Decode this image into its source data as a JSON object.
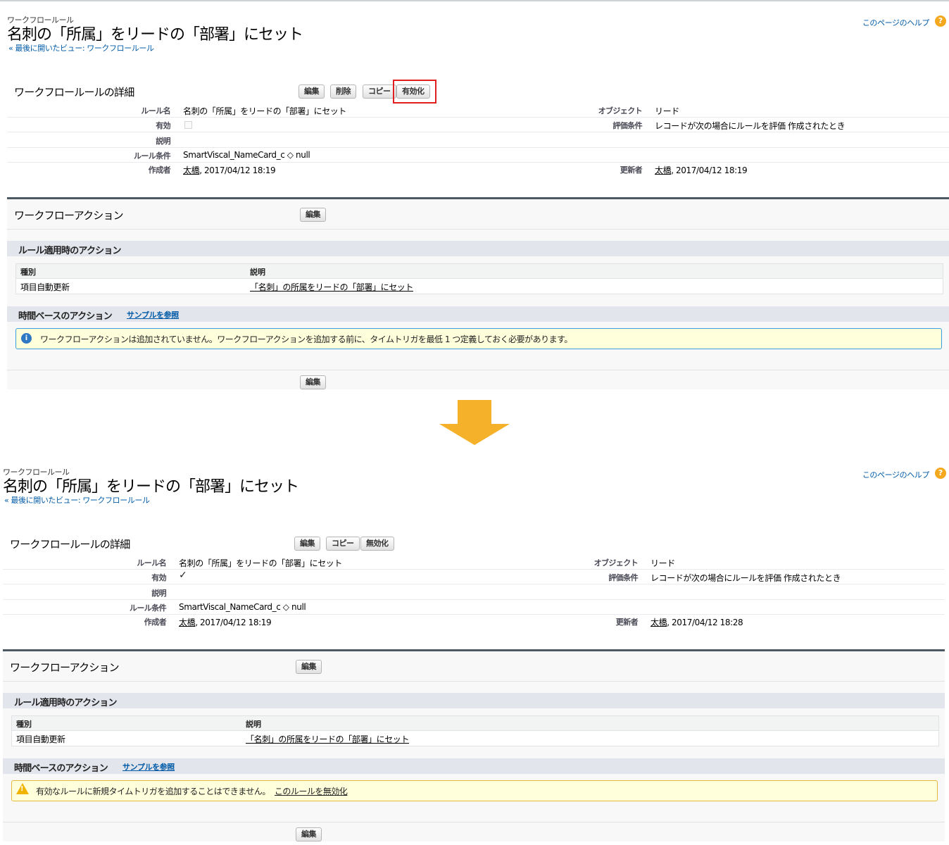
{
  "before": {
    "breadcrumb": "ワークフロールール",
    "title": "名刺の「所属」をリードの「部署」にセット",
    "back_link": "« 最後に開いたビュー: ワークフロールール",
    "help_link": "このページのヘルプ",
    "detail": {
      "heading": "ワークフロールールの詳細",
      "buttons": [
        "編集",
        "削除",
        "コピー",
        "有効化"
      ],
      "highlighted_button": "有効化",
      "rule_name_label": "ルール名",
      "rule_name_value": "名刺の「所属」をリードの「部署」にセット",
      "active_label": "有効",
      "active_value": false,
      "description_label": "説明",
      "criteria_label": "ルール条件",
      "criteria_value": "SmartViscal_NameCard_c ◇ null",
      "created_label": "作成者",
      "created_user": "太橋",
      "created_date": ", 2017/04/12 18:19",
      "object_label": "オブジェクト",
      "object_value": "リード",
      "eval_label": "評価条件",
      "eval_value": "レコードが次の場合にルールを評価 作成されたとき",
      "modified_label": "更新者",
      "modified_user": "太橋",
      "modified_date": ", 2017/04/12 18:19"
    },
    "actions": {
      "heading": "ワークフローアクション",
      "edit_label": "編集",
      "immediate_heading": "ルール適用時のアクション",
      "col_type": "種別",
      "col_desc": "説明",
      "row_type": "項目自動更新",
      "row_desc": "「名刺」の所属をリードの「部署」にセット",
      "time_heading": "時間ベースのアクション",
      "sample_link": "サンプルを参照",
      "message": "ワークフローアクションは追加されていません。ワークフローアクションを追加する前に、タイムトリガを最低 1 つ定義しておく必要があります。",
      "bottom_edit_label": "編集"
    }
  },
  "after": {
    "breadcrumb": "ワークフロールール",
    "title": "名刺の「所属」をリードの「部署」にセット",
    "back_link": "« 最後に開いたビュー: ワークフロールール",
    "help_link": "このページのヘルプ",
    "detail": {
      "heading": "ワークフロールールの詳細",
      "buttons": [
        "編集",
        "コピー",
        "無効化"
      ],
      "rule_name_label": "ルール名",
      "rule_name_value": "名刺の「所属」をリードの「部署」にセット",
      "active_label": "有効",
      "active_value": true,
      "description_label": "説明",
      "criteria_label": "ルール条件",
      "criteria_value": "SmartViscal_NameCard_c ◇ null",
      "created_label": "作成者",
      "created_user": "太橋",
      "created_date": ", 2017/04/12 18:19",
      "object_label": "オブジェクト",
      "object_value": "リード",
      "eval_label": "評価条件",
      "eval_value": "レコードが次の場合にルールを評価 作成されたとき",
      "modified_label": "更新者",
      "modified_user": "太橋",
      "modified_date": ", 2017/04/12 18:28"
    },
    "actions": {
      "heading": "ワークフローアクション",
      "edit_label": "編集",
      "immediate_heading": "ルール適用時のアクション",
      "col_type": "種別",
      "col_desc": "説明",
      "row_type": "項目自動更新",
      "row_desc": "「名刺」の所属をリードの「部署」にセット",
      "time_heading": "時間ベースのアクション",
      "sample_link": "サンプルを参照",
      "message": "有効なルールに新規タイムトリガを追加することはできません。",
      "message_link": "このルールを無効化",
      "bottom_edit_label": "編集"
    }
  },
  "colors": {
    "link": "#015ba7",
    "highlight": "#e02020",
    "arrow": "#f6b12b",
    "section_bar": "#4d5962"
  }
}
